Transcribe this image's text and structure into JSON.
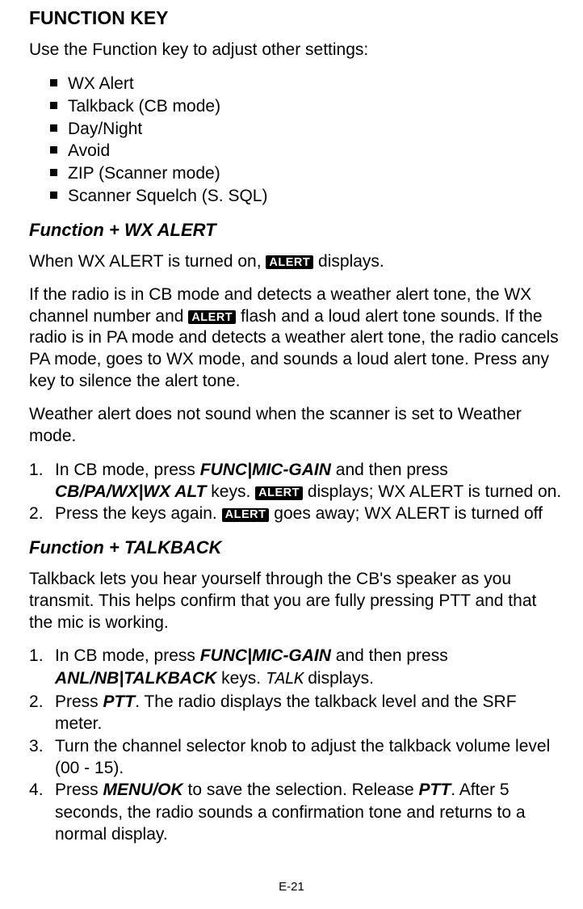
{
  "title": "FUNCTION KEY",
  "intro": "Use the Function key to adjust other settings:",
  "bullets": [
    "WX Alert",
    "Talkback (CB mode)",
    "Day/Night",
    "Avoid",
    "ZIP (Scanner mode)",
    "Scanner Squelch (S. SQL)"
  ],
  "alert_badge": "ALERT",
  "wx": {
    "heading": "Function + WX ALERT",
    "p1_pre": "When WX ALERT is turned on, ",
    "p1_post": " displays.",
    "p2_a": "If the radio is in CB mode and detects a weather alert tone, the WX channel number and ",
    "p2_b": " flash and a loud alert tone sounds. If the radio is in PA mode and detects a weather alert tone, the radio cancels PA mode, goes to WX mode, and sounds a loud alert tone. Press any key to silence the alert tone.",
    "p3": "Weather alert does not sound when the scanner is set to Weather mode.",
    "s1_a": "In CB mode, press ",
    "s1_key1": "FUNC|MIC-GAIN",
    "s1_b": " and then press ",
    "s1_key2": "CB/PA/WX|WX ALT",
    "s1_c": " keys. ",
    "s1_d": " displays; WX ALERT is turned on.",
    "s2_a": "Press the keys again. ",
    "s2_b": " goes away; WX ALERT is turned off"
  },
  "tb": {
    "heading": "Function + TALKBACK",
    "p1": "Talkback lets you hear yourself through the CB's speaker as you transmit. This helps confirm that you are fully pressing PTT and that the mic is working.",
    "s1_a": "In CB mode, press ",
    "s1_key1": "FUNC|MIC-GAIN",
    "s1_b": " and then press ",
    "s1_key2": "ANL/NB|TALKBACK",
    "s1_c": " keys. ",
    "s1_lcd": "TALK",
    "s1_d": " displays.",
    "s2_a": "Press ",
    "s2_key": "PTT",
    "s2_b": ". The radio displays the talkback level and the SRF meter.",
    "s3": "Turn the channel selector knob to adjust the talkback volume level (00 - 15).",
    "s4_a": "Press ",
    "s4_key1": "MENU/OK",
    "s4_b": " to save the selection. Release ",
    "s4_key2": "PTT",
    "s4_c": ". After 5 seconds, the radio sounds a confirmation tone and returns to a normal display."
  },
  "page_num": "E-21"
}
